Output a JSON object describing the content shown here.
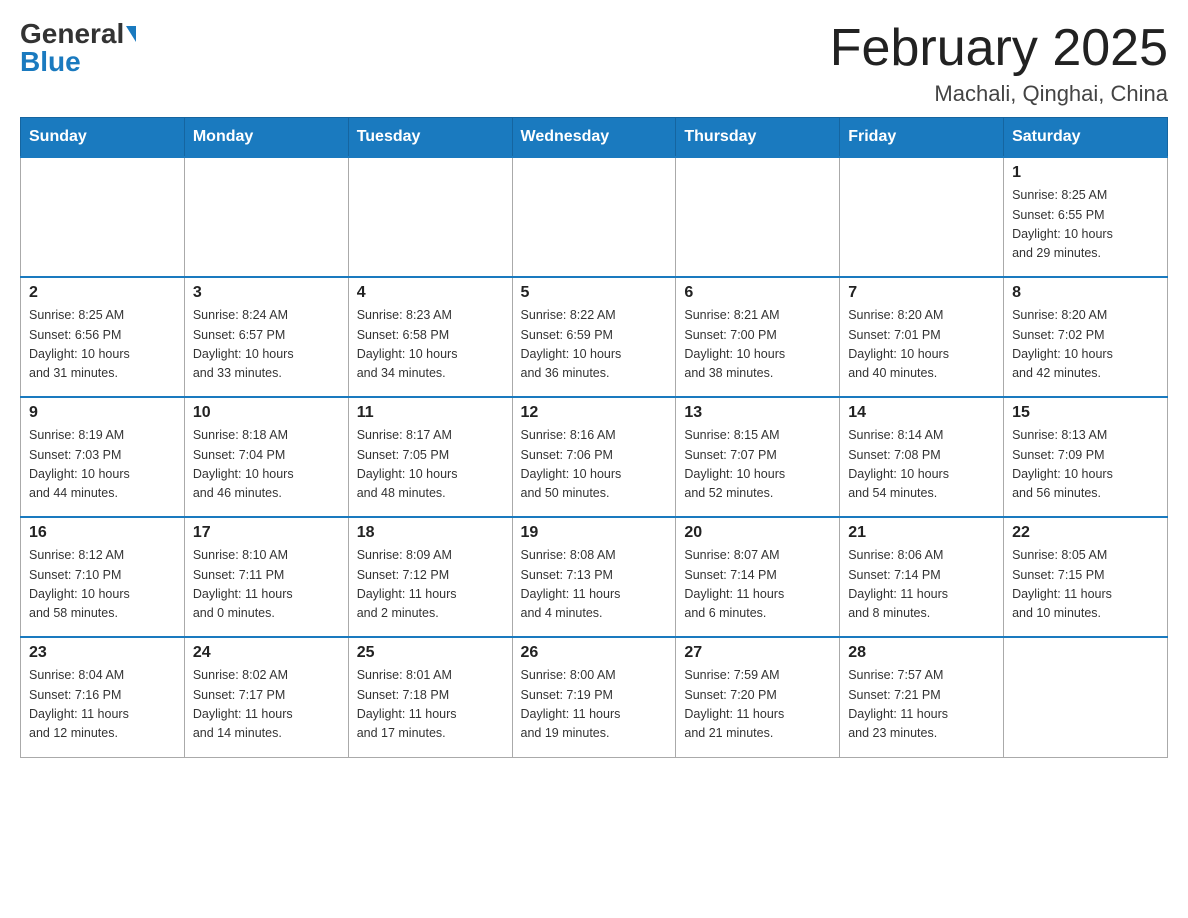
{
  "logo": {
    "general": "General",
    "blue": "Blue"
  },
  "title": "February 2025",
  "location": "Machali, Qinghai, China",
  "days_of_week": [
    "Sunday",
    "Monday",
    "Tuesday",
    "Wednesday",
    "Thursday",
    "Friday",
    "Saturday"
  ],
  "weeks": [
    [
      {
        "day": "",
        "info": ""
      },
      {
        "day": "",
        "info": ""
      },
      {
        "day": "",
        "info": ""
      },
      {
        "day": "",
        "info": ""
      },
      {
        "day": "",
        "info": ""
      },
      {
        "day": "",
        "info": ""
      },
      {
        "day": "1",
        "info": "Sunrise: 8:25 AM\nSunset: 6:55 PM\nDaylight: 10 hours\nand 29 minutes."
      }
    ],
    [
      {
        "day": "2",
        "info": "Sunrise: 8:25 AM\nSunset: 6:56 PM\nDaylight: 10 hours\nand 31 minutes."
      },
      {
        "day": "3",
        "info": "Sunrise: 8:24 AM\nSunset: 6:57 PM\nDaylight: 10 hours\nand 33 minutes."
      },
      {
        "day": "4",
        "info": "Sunrise: 8:23 AM\nSunset: 6:58 PM\nDaylight: 10 hours\nand 34 minutes."
      },
      {
        "day": "5",
        "info": "Sunrise: 8:22 AM\nSunset: 6:59 PM\nDaylight: 10 hours\nand 36 minutes."
      },
      {
        "day": "6",
        "info": "Sunrise: 8:21 AM\nSunset: 7:00 PM\nDaylight: 10 hours\nand 38 minutes."
      },
      {
        "day": "7",
        "info": "Sunrise: 8:20 AM\nSunset: 7:01 PM\nDaylight: 10 hours\nand 40 minutes."
      },
      {
        "day": "8",
        "info": "Sunrise: 8:20 AM\nSunset: 7:02 PM\nDaylight: 10 hours\nand 42 minutes."
      }
    ],
    [
      {
        "day": "9",
        "info": "Sunrise: 8:19 AM\nSunset: 7:03 PM\nDaylight: 10 hours\nand 44 minutes."
      },
      {
        "day": "10",
        "info": "Sunrise: 8:18 AM\nSunset: 7:04 PM\nDaylight: 10 hours\nand 46 minutes."
      },
      {
        "day": "11",
        "info": "Sunrise: 8:17 AM\nSunset: 7:05 PM\nDaylight: 10 hours\nand 48 minutes."
      },
      {
        "day": "12",
        "info": "Sunrise: 8:16 AM\nSunset: 7:06 PM\nDaylight: 10 hours\nand 50 minutes."
      },
      {
        "day": "13",
        "info": "Sunrise: 8:15 AM\nSunset: 7:07 PM\nDaylight: 10 hours\nand 52 minutes."
      },
      {
        "day": "14",
        "info": "Sunrise: 8:14 AM\nSunset: 7:08 PM\nDaylight: 10 hours\nand 54 minutes."
      },
      {
        "day": "15",
        "info": "Sunrise: 8:13 AM\nSunset: 7:09 PM\nDaylight: 10 hours\nand 56 minutes."
      }
    ],
    [
      {
        "day": "16",
        "info": "Sunrise: 8:12 AM\nSunset: 7:10 PM\nDaylight: 10 hours\nand 58 minutes."
      },
      {
        "day": "17",
        "info": "Sunrise: 8:10 AM\nSunset: 7:11 PM\nDaylight: 11 hours\nand 0 minutes."
      },
      {
        "day": "18",
        "info": "Sunrise: 8:09 AM\nSunset: 7:12 PM\nDaylight: 11 hours\nand 2 minutes."
      },
      {
        "day": "19",
        "info": "Sunrise: 8:08 AM\nSunset: 7:13 PM\nDaylight: 11 hours\nand 4 minutes."
      },
      {
        "day": "20",
        "info": "Sunrise: 8:07 AM\nSunset: 7:14 PM\nDaylight: 11 hours\nand 6 minutes."
      },
      {
        "day": "21",
        "info": "Sunrise: 8:06 AM\nSunset: 7:14 PM\nDaylight: 11 hours\nand 8 minutes."
      },
      {
        "day": "22",
        "info": "Sunrise: 8:05 AM\nSunset: 7:15 PM\nDaylight: 11 hours\nand 10 minutes."
      }
    ],
    [
      {
        "day": "23",
        "info": "Sunrise: 8:04 AM\nSunset: 7:16 PM\nDaylight: 11 hours\nand 12 minutes."
      },
      {
        "day": "24",
        "info": "Sunrise: 8:02 AM\nSunset: 7:17 PM\nDaylight: 11 hours\nand 14 minutes."
      },
      {
        "day": "25",
        "info": "Sunrise: 8:01 AM\nSunset: 7:18 PM\nDaylight: 11 hours\nand 17 minutes."
      },
      {
        "day": "26",
        "info": "Sunrise: 8:00 AM\nSunset: 7:19 PM\nDaylight: 11 hours\nand 19 minutes."
      },
      {
        "day": "27",
        "info": "Sunrise: 7:59 AM\nSunset: 7:20 PM\nDaylight: 11 hours\nand 21 minutes."
      },
      {
        "day": "28",
        "info": "Sunrise: 7:57 AM\nSunset: 7:21 PM\nDaylight: 11 hours\nand 23 minutes."
      },
      {
        "day": "",
        "info": ""
      }
    ]
  ]
}
